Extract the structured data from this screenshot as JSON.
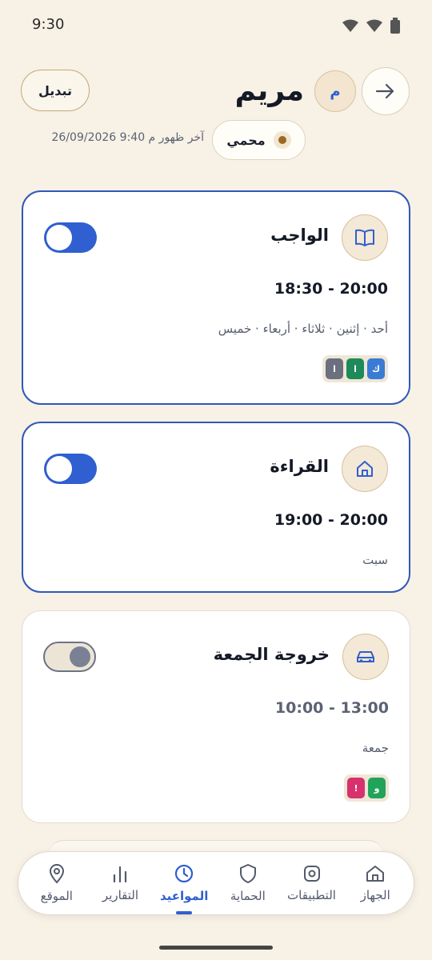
{
  "status_bar": {
    "time": "9:30"
  },
  "header": {
    "child_name": "مريم",
    "avatar_initial": "م",
    "switch_label": "تبديل",
    "status_label": "محمي",
    "last_seen": "آخر ظهور م 9:40 26/09/2026"
  },
  "schedules": [
    {
      "title": "الواجب",
      "icon": "book-icon",
      "time": "18:30 - 20:00",
      "days": "أحد · إثنين · ثلاثاء · أربعاء · خميس",
      "enabled": true,
      "badges": [
        {
          "letter": "ك",
          "color": "#3a7bd5"
        },
        {
          "letter": "ا",
          "color": "#1e8a5a"
        },
        {
          "letter": "ا",
          "color": "#6b7080"
        }
      ]
    },
    {
      "title": "القراءة",
      "icon": "home-icon",
      "time": "19:00 - 20:00",
      "days": "سبت",
      "enabled": true,
      "badges": []
    },
    {
      "title": "خروجة الجمعة",
      "icon": "car-icon",
      "time": "10:00 - 13:00",
      "days": "جمعة",
      "enabled": false,
      "badges": [
        {
          "letter": "و",
          "color": "#21a35a"
        },
        {
          "letter": "!",
          "color": "#d8326e"
        }
      ]
    }
  ],
  "nav": [
    {
      "label": "الجهاز",
      "icon": "house-icon",
      "active": false
    },
    {
      "label": "التطبيقات",
      "icon": "apps-icon",
      "active": false
    },
    {
      "label": "الحماية",
      "icon": "shield-icon",
      "active": false
    },
    {
      "label": "المواعيد",
      "icon": "clock-icon",
      "active": true
    },
    {
      "label": "التقارير",
      "icon": "bar-chart-icon",
      "active": false
    },
    {
      "label": "الموقع",
      "icon": "location-pin-icon",
      "active": false
    }
  ],
  "colors": {
    "accent": "#2f5fd0",
    "background": "#f7f1e6",
    "protected_dot": "#9a6a24"
  }
}
